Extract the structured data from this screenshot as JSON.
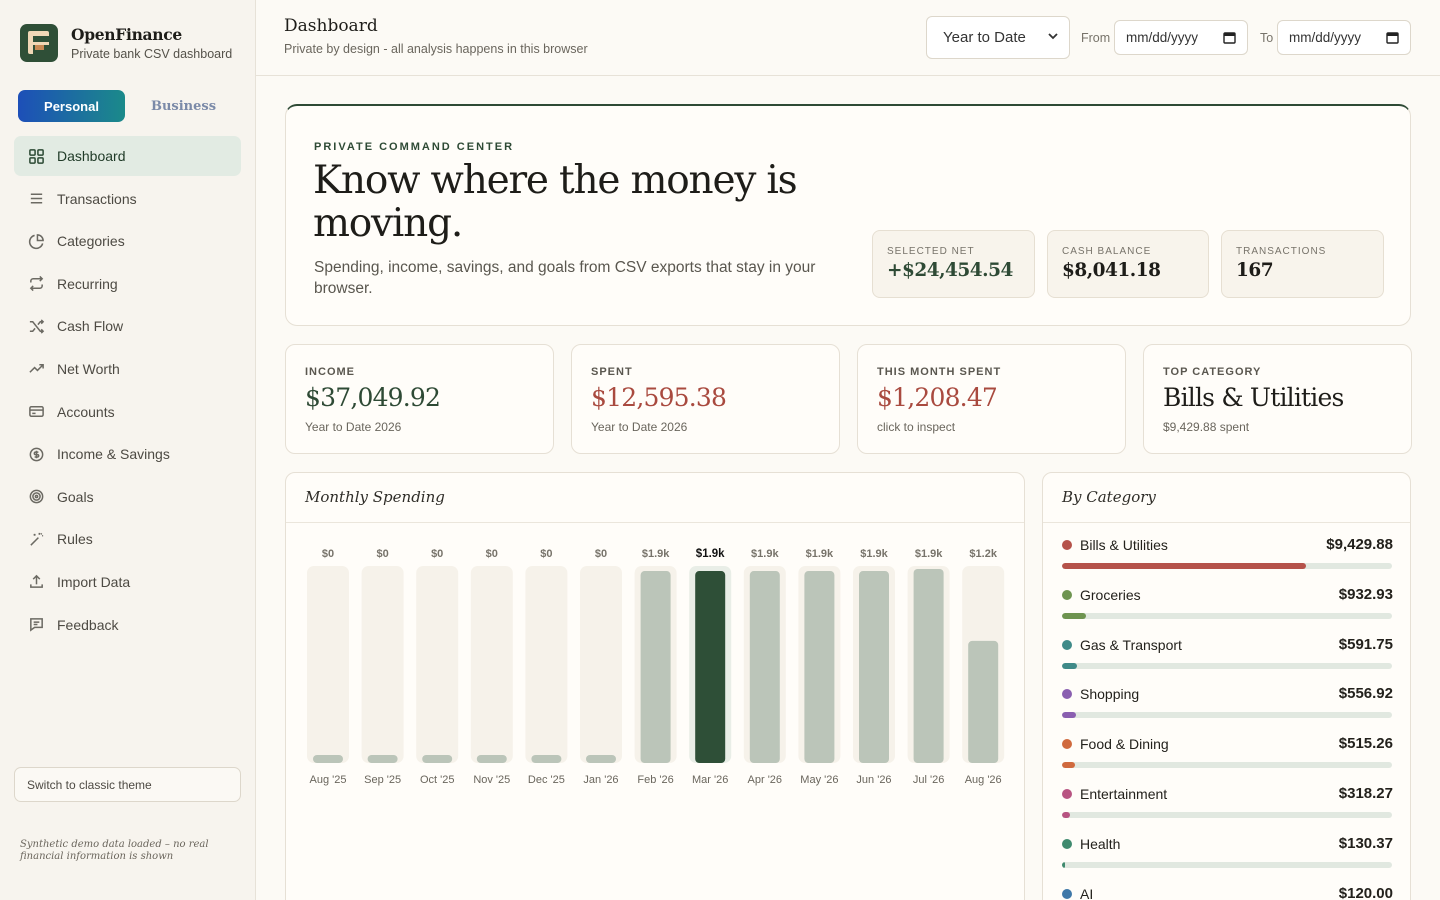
{
  "brand": {
    "name": "OpenFinance",
    "subtitle": "Private bank CSV dashboard"
  },
  "mode_toggle": {
    "personal": "Personal",
    "business": "Business",
    "selected": "Personal"
  },
  "nav": [
    {
      "label": "Dashboard",
      "icon": "grid-icon",
      "active": true
    },
    {
      "label": "Transactions",
      "icon": "list-icon"
    },
    {
      "label": "Categories",
      "icon": "pie-icon"
    },
    {
      "label": "Recurring",
      "icon": "repeat-icon"
    },
    {
      "label": "Cash Flow",
      "icon": "shuffle-icon"
    },
    {
      "label": "Net Worth",
      "icon": "trending-up-icon"
    },
    {
      "label": "Accounts",
      "icon": "card-icon"
    },
    {
      "label": "Income & Savings",
      "icon": "coin-icon"
    },
    {
      "label": "Goals",
      "icon": "target-icon"
    },
    {
      "label": "Rules",
      "icon": "wand-icon"
    },
    {
      "label": "Import Data",
      "icon": "upload-icon"
    },
    {
      "label": "Feedback",
      "icon": "message-icon"
    }
  ],
  "sidebar_footer": {
    "classic_theme": "Switch to classic theme",
    "demo_note": "Synthetic demo data loaded – no real financial information is shown"
  },
  "header": {
    "title": "Dashboard",
    "subtitle": "Private by design - all analysis happens in this browser",
    "range": "Year to Date",
    "from_label": "From",
    "to_label": "To",
    "date_placeholder": "mm/dd/yyyy"
  },
  "hero": {
    "kicker": "PRIVATE COMMAND CENTER",
    "title": "Know where the money is moving.",
    "description": "Spending, income, savings, and goals from CSV exports that stay in your browser.",
    "stats": [
      {
        "label": "SELECTED NET",
        "value": "+$24,454.54"
      },
      {
        "label": "CASH BALANCE",
        "value": "$8,041.18"
      },
      {
        "label": "TRANSACTIONS",
        "value": "167"
      }
    ]
  },
  "kpis": [
    {
      "label": "INCOME",
      "value": "$37,049.92",
      "sub": "Year to Date 2026",
      "tone": "green"
    },
    {
      "label": "SPENT",
      "value": "$12,595.38",
      "sub": "Year to Date 2026",
      "tone": "red"
    },
    {
      "label": "THIS MONTH SPENT",
      "value": "$1,208.47",
      "sub": "click to inspect",
      "tone": "red"
    },
    {
      "label": "TOP CATEGORY",
      "value": "Bills & Utilities",
      "sub": "$9,429.88 spent",
      "tone": "dark"
    }
  ],
  "monthly_card": {
    "title": "Monthly Spending"
  },
  "category_card": {
    "title": "By Category",
    "items": [
      {
        "name": "Bills & Utilities",
        "amount": "$9,429.88",
        "value": 9429.88,
        "color": "#b5524a"
      },
      {
        "name": "Groceries",
        "amount": "$932.93",
        "value": 932.93,
        "color": "#6e9450"
      },
      {
        "name": "Gas & Transport",
        "amount": "$591.75",
        "value": 591.75,
        "color": "#3f8a88"
      },
      {
        "name": "Shopping",
        "amount": "$556.92",
        "value": 556.92,
        "color": "#8a5fb0"
      },
      {
        "name": "Food & Dining",
        "amount": "$515.26",
        "value": 515.26,
        "color": "#d06a3e"
      },
      {
        "name": "Entertainment",
        "amount": "$318.27",
        "value": 318.27,
        "color": "#b85482"
      },
      {
        "name": "Health",
        "amount": "$130.37",
        "value": 130.37,
        "color": "#3f8a6e"
      },
      {
        "name": "AI",
        "amount": "$120.00",
        "value": 120.0,
        "color": "#3f78a8"
      }
    ]
  },
  "chart_data": {
    "type": "bar",
    "title": "Monthly Spending",
    "categories": [
      "Aug '25",
      "Sep '25",
      "Oct '25",
      "Nov '25",
      "Dec '25",
      "Jan '26",
      "Feb '26",
      "Mar '26",
      "Apr '26",
      "May '26",
      "Jun '26",
      "Jul '26",
      "Aug '26"
    ],
    "values": [
      0,
      0,
      0,
      0,
      0,
      0,
      1900,
      1900,
      1900,
      1900,
      1900,
      1920,
      1208.47
    ],
    "data_labels": [
      "$0",
      "$0",
      "$0",
      "$0",
      "$0",
      "$0",
      "$1.9k",
      "$1.9k",
      "$1.9k",
      "$1.9k",
      "$1.9k",
      "$1.9k",
      "$1.2k"
    ],
    "highlighted": "Mar '26",
    "colors": {
      "bar": "#bbc5b9",
      "highlight": "#2e4f37",
      "track": "#f6f2ea",
      "zero_stub": "#bbc5b9"
    }
  }
}
